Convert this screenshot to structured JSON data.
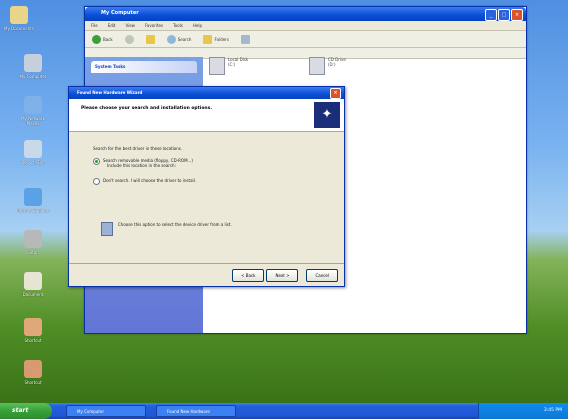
{
  "desktop": {
    "icons": [
      {
        "label": "My Documents",
        "color": "#e8d58a"
      },
      {
        "label": "My Computer",
        "color": "#c6cfdc"
      },
      {
        "label": "My Network Places",
        "color": "#7fb1e8"
      },
      {
        "label": "Recycle Bin",
        "color": "#c9d9e8"
      },
      {
        "label": "Internet Explorer",
        "color": "#5aa1e6"
      },
      {
        "label": "Setup",
        "color": "#b8b8b8"
      },
      {
        "label": "Document",
        "color": "#e8e4d4"
      },
      {
        "label": "Shortcut",
        "color": "#e0a878"
      },
      {
        "label": "Shortcut",
        "color": "#d89a70"
      }
    ]
  },
  "explorer": {
    "title": "My Computer",
    "menu": [
      "File",
      "Edit",
      "View",
      "Favorites",
      "Tools",
      "Help"
    ],
    "toolbar": {
      "back": "Back",
      "search": "Search",
      "folders": "Folders"
    },
    "task_panel_title": "System Tasks",
    "files": [
      {
        "name": "Local Disk",
        "detail": "(C:)"
      },
      {
        "name": "CD Drive",
        "detail": "(D:)"
      }
    ]
  },
  "dialog": {
    "title": "Found New Hardware Wizard",
    "heading": "Please choose your search and installation options.",
    "subheading": "",
    "question": "Search for the best driver in these locations.",
    "options": [
      {
        "label": "Search removable media (floppy, CD-ROM...)",
        "sub": "Include this location in the search:",
        "checked": true
      },
      {
        "label": "Don't search. I will choose the driver to install.",
        "sub": "",
        "checked": false
      }
    ],
    "note": "Choose this option to select the device driver from a list.",
    "buttons": {
      "back": "< Back",
      "next": "Next >",
      "cancel": "Cancel"
    }
  },
  "taskbar": {
    "start": "start",
    "tasks": [
      "My Computer",
      "Found New Hardware"
    ],
    "clock": "3:45 PM"
  }
}
